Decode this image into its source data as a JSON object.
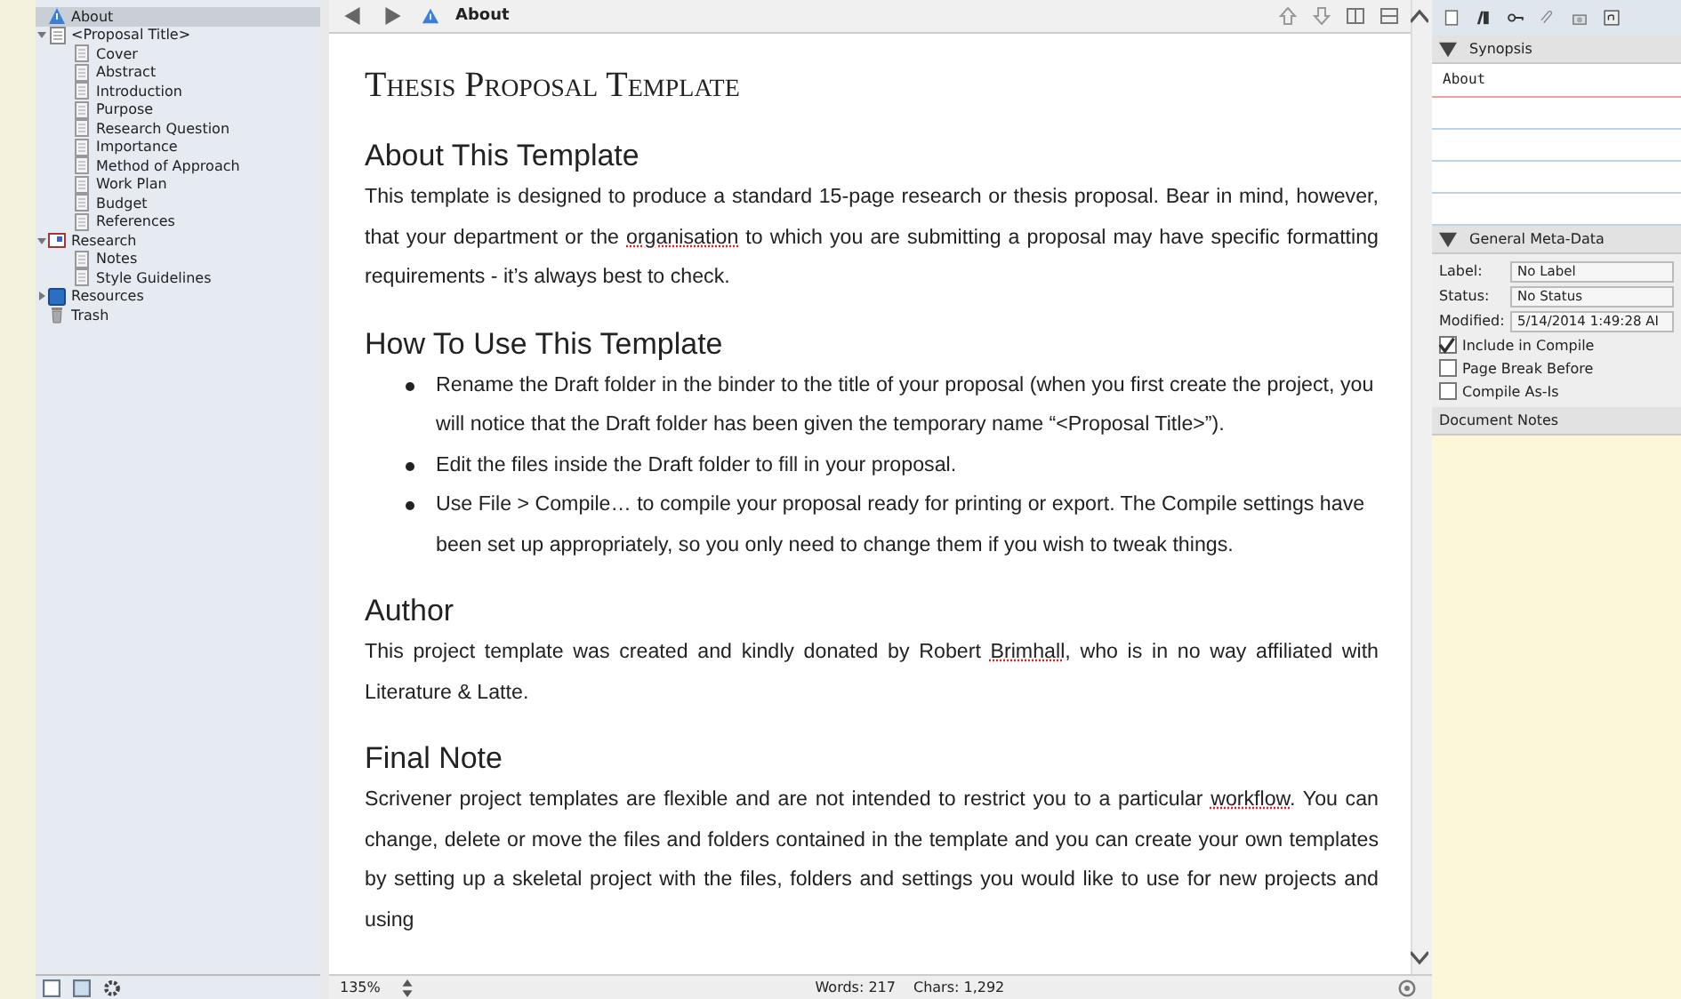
{
  "binder": {
    "items": [
      {
        "label": "About",
        "kind": "info",
        "selected": true
      },
      {
        "label": "<Proposal Title>",
        "kind": "folder",
        "expanded": true,
        "selected": false,
        "children": [
          {
            "label": "Cover",
            "kind": "document",
            "selected": false
          },
          {
            "label": "Abstract",
            "kind": "document",
            "selected": false
          },
          {
            "label": "Introduction",
            "kind": "document",
            "selected": false
          },
          {
            "label": "Purpose",
            "kind": "document",
            "selected": false
          },
          {
            "label": "Research Question",
            "kind": "document",
            "selected": false
          },
          {
            "label": "Importance",
            "kind": "document",
            "selected": false
          },
          {
            "label": "Method of Approach",
            "kind": "document",
            "selected": false
          },
          {
            "label": "Work Plan",
            "kind": "document",
            "selected": false
          },
          {
            "label": "Budget",
            "kind": "document",
            "selected": false
          },
          {
            "label": "References",
            "kind": "document",
            "selected": false
          }
        ]
      },
      {
        "label": "Research",
        "kind": "research",
        "expanded": true,
        "selected": false,
        "children": [
          {
            "label": "Notes",
            "kind": "document",
            "selected": false
          },
          {
            "label": "Style Guidelines",
            "kind": "document",
            "selected": false
          }
        ]
      },
      {
        "label": "Resources",
        "kind": "resources",
        "expanded": false,
        "selected": false
      },
      {
        "label": "Trash",
        "kind": "trash",
        "selected": false
      }
    ]
  },
  "editor": {
    "header_title": "About",
    "zoom": "135%",
    "word_count": "Words: 217",
    "char_count": "Chars: 1,292",
    "blocks": [
      {
        "kind": "title",
        "text": "Thesis Proposal Template"
      },
      {
        "kind": "heading",
        "text": "About This Template"
      },
      {
        "kind": "paragraph",
        "segments": [
          {
            "text": "This template is designed to produce a standard 15-page research or thesis proposal. Bear in mind, however, that your department or the ",
            "misspelled": false
          },
          {
            "text": "organisation",
            "misspelled": true
          },
          {
            "text": " to which you are submitting a proposal may have specific formatting requirements - it’s always best to check.",
            "misspelled": false
          }
        ]
      },
      {
        "kind": "heading",
        "text": "How To Use This Template"
      },
      {
        "kind": "bullets",
        "items": [
          "Rename the Draft folder in the binder to the title of your proposal (when you first create the project, you will notice that the Draft folder has been given the temporary name “<Proposal Title>”).",
          "Edit the files inside the Draft folder to fill in your proposal.",
          "Use File > Compile… to compile your proposal ready for printing or export. The Compile settings have been set up appropriately, so you only need to change them if you wish to tweak things."
        ]
      },
      {
        "kind": "heading",
        "text": "Author"
      },
      {
        "kind": "paragraph",
        "segments": [
          {
            "text": "This project template was created and kindly donated by Robert ",
            "misspelled": false
          },
          {
            "text": "Brimhall",
            "misspelled": true
          },
          {
            "text": ", who is in no way affiliated with Literature & Latte.",
            "misspelled": false
          }
        ]
      },
      {
        "kind": "heading",
        "text": "Final Note"
      },
      {
        "kind": "paragraph",
        "segments": [
          {
            "text": "Scrivener project templates are flexible and are not intended to restrict you to a particular ",
            "misspelled": false
          },
          {
            "text": "workflow",
            "misspelled": true
          },
          {
            "text": ". You can change, delete or move the files and folders contained in the template and you can create your own templates by setting up a skeletal project with the files, folders and settings you would like to use for new projects and using",
            "misspelled": false
          }
        ]
      }
    ]
  },
  "inspector": {
    "synopsis_header": "Synopsis",
    "synopsis": "About",
    "meta_header": "General Meta-Data",
    "fields": [
      {
        "label": "Label:",
        "value": "No Label"
      },
      {
        "label": "Status:",
        "value": "No Status"
      },
      {
        "label": "Modified:",
        "value": "5/14/2014 1:49:28 AI"
      }
    ],
    "checkboxes": [
      {
        "label": "Include in Compile",
        "checked": true
      },
      {
        "label": "Page Break Before",
        "checked": false
      },
      {
        "label": "Compile As-Is",
        "checked": false
      }
    ],
    "notes_header": "Document Notes"
  }
}
